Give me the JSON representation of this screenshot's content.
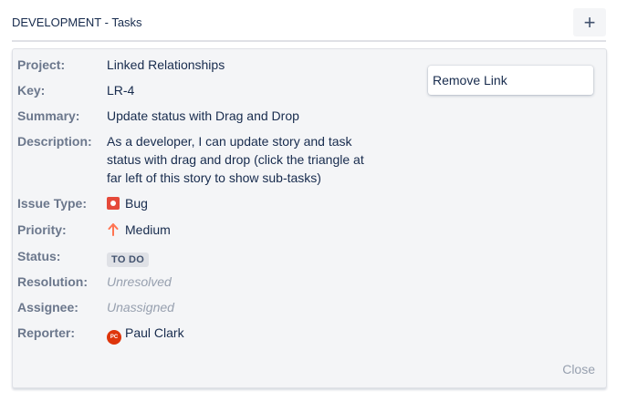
{
  "header": {
    "title": "DEVELOPMENT - Tasks",
    "add_label": "+"
  },
  "issue": {
    "project": {
      "label": "Project:",
      "value": "Linked Relationships"
    },
    "key": {
      "label": "Key:",
      "value": "LR-4"
    },
    "summary": {
      "label": "Summary:",
      "value": "Update status with Drag and Drop"
    },
    "description": {
      "label": "Description:",
      "value": "As a developer, I can update story and task status with drag and drop (click the triangle at far left of this story to show sub-tasks)"
    },
    "issue_type": {
      "label": "Issue Type:",
      "value": "Bug",
      "icon": "bug-icon",
      "color": "#e5493a"
    },
    "priority": {
      "label": "Priority:",
      "value": "Medium",
      "icon": "arrow-up-icon",
      "color": "#ff7452"
    },
    "status": {
      "label": "Status:",
      "value": "TO DO"
    },
    "resolution": {
      "label": "Resolution:",
      "value": "Unresolved"
    },
    "assignee": {
      "label": "Assignee:",
      "value": "Unassigned"
    },
    "reporter": {
      "label": "Reporter:",
      "value": "Paul Clark",
      "avatar_initials": "PC",
      "avatar_color": "#de350b"
    }
  },
  "actions": {
    "remove_link": "Remove Link",
    "close": "Close"
  }
}
